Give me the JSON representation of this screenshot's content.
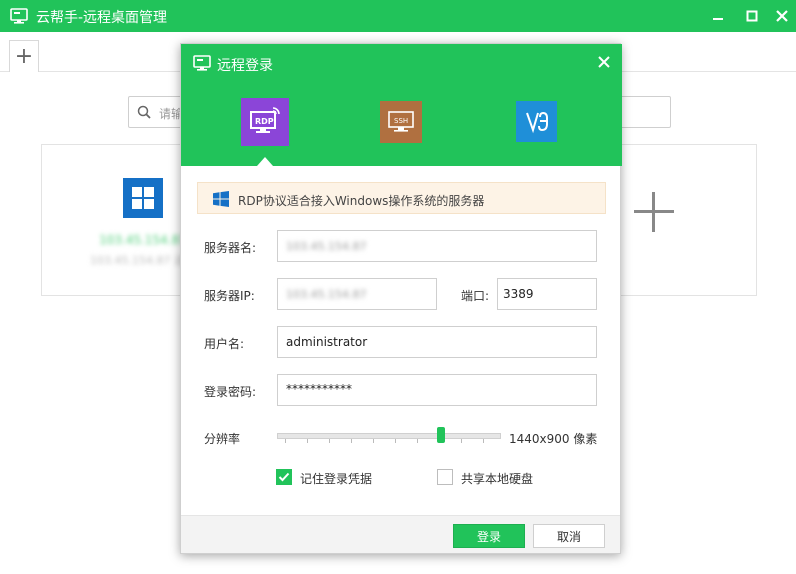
{
  "window": {
    "title": "云帮手-远程桌面管理",
    "tab_add": "+"
  },
  "background": {
    "search_placeholder": "请输",
    "card_ip": "103.45.154.87",
    "card_sub": "103.45.154.87 远程"
  },
  "dialog": {
    "title": "远程登录",
    "protocols": [
      {
        "name": "RDP",
        "active": true
      },
      {
        "name": "SSH",
        "active": false
      },
      {
        "name": "VNC",
        "active": false
      }
    ],
    "info": "RDP协议适合接入Windows操作系统的服务器",
    "server_name_label": "服务器名:",
    "server_name_value": "103.45.154.87",
    "server_ip_label": "服务器IP:",
    "server_ip_value": "103.45.154.87",
    "port_label": "端口:",
    "port_value": "3389",
    "username_label": "用户名:",
    "username_value": "administrator",
    "password_label": "登录密码:",
    "password_value": "***********",
    "resolution_label": "分辨率",
    "resolution_value": "1440x900 像素",
    "resolution_level": 0.74,
    "remember_label": "记住登录凭据",
    "remember_checked": true,
    "share_disk_label": "共享本地硬盘",
    "share_disk_checked": false,
    "login_button": "登录",
    "cancel_button": "取消"
  },
  "colors": {
    "brand_green": "#21c35a",
    "rdp_purple": "#8b45d8",
    "ssh_brown": "#b07040",
    "vnc_blue": "#1f8fd8",
    "windows_blue": "#1570c6"
  }
}
